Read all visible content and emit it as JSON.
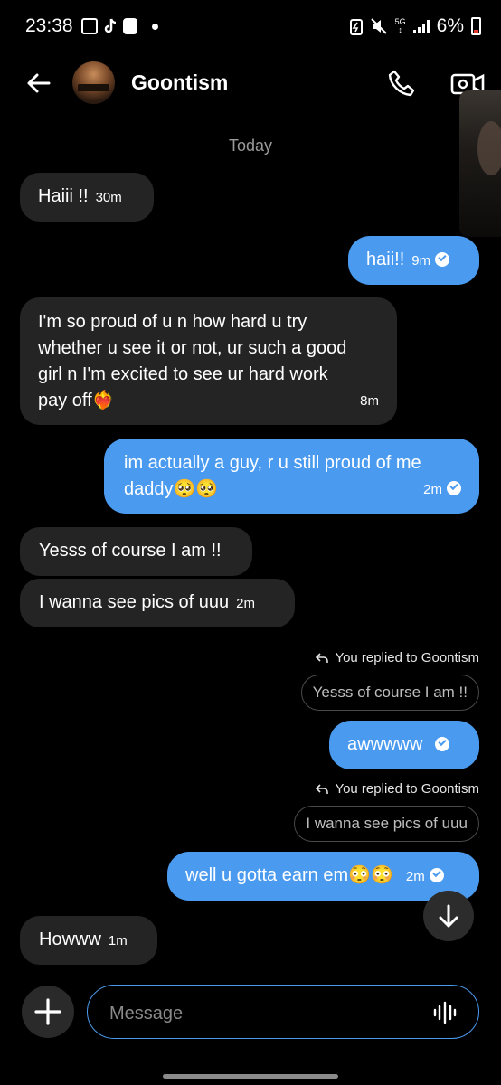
{
  "status_bar": {
    "time": "23:38",
    "battery": "6%",
    "network": "5G"
  },
  "header": {
    "contact_name": "Goontism"
  },
  "divider": "Today",
  "messages": [
    {
      "text": "Haiii !!",
      "time": "30m"
    },
    {
      "text": "haii!!",
      "time": "9m"
    },
    {
      "line1": "I'm so proud of u n how hard u try",
      "line2": "whether u see it or not, ur such a good",
      "line3": "girl n I'm excited to see ur hard work",
      "line4": "pay off❤️‍🔥",
      "time": "8m"
    },
    {
      "line1": "im actually a guy, r u still proud of me",
      "line2": "daddy🥺🥺",
      "time": "2m"
    },
    {
      "text": "Yesss of course I am !!"
    },
    {
      "text": "I wanna see pics of uuu",
      "time": "2m"
    },
    {
      "reply_label": "You replied to Goontism",
      "quoted": "Yesss of course I am !!",
      "text": "awwwww"
    },
    {
      "reply_label": "You replied to Goontism",
      "quoted": "I wanna see pics of uuu",
      "text": "well u gotta earn em😳😳",
      "time": "2m"
    },
    {
      "text": "Howww",
      "time": "1m"
    }
  ],
  "composer": {
    "placeholder": "Message"
  },
  "colors": {
    "accent": "#4a9bf0",
    "incoming_bubble": "#242424",
    "background": "#000000"
  }
}
